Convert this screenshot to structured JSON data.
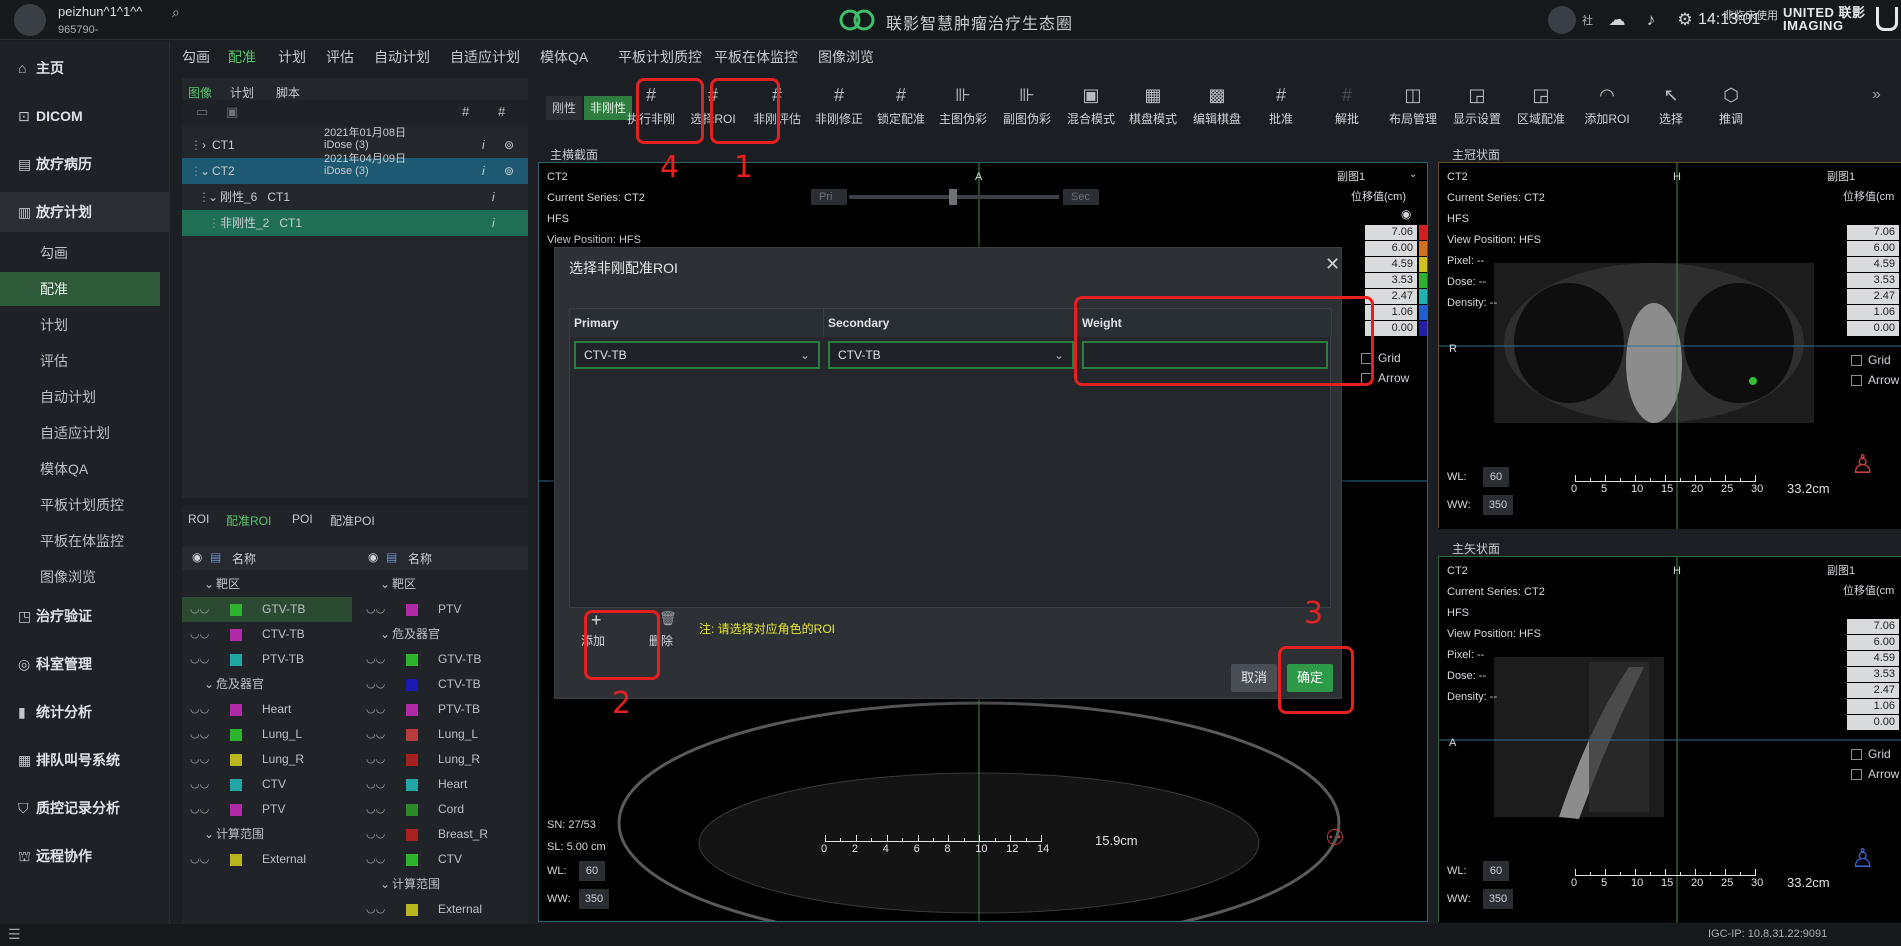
{
  "app": {
    "brand": "联影智慧肿瘤治疗生态圈",
    "clock": "14:13:01",
    "community": "社",
    "nonclinical": "非临床使用",
    "united_imaging": "UNITED 联影 IMAGING"
  },
  "user": {
    "name": "peizhun^1^1^^",
    "id": "965790-"
  },
  "sidebar": {
    "items": [
      {
        "label": "主页",
        "icon": "home-icon",
        "glyph": "⌂"
      },
      {
        "label": "DICOM",
        "icon": "dicom-icon",
        "glyph": "⊡"
      },
      {
        "label": "放疗病历",
        "icon": "record-icon",
        "glyph": "▤"
      },
      {
        "label": "放疗计划",
        "icon": "plan-icon",
        "glyph": "▥"
      },
      {
        "label": "治疗验证",
        "icon": "verify-icon",
        "glyph": "◳"
      },
      {
        "label": "科室管理",
        "icon": "dept-icon",
        "glyph": "◎"
      },
      {
        "label": "统计分析",
        "icon": "stats-icon",
        "glyph": "▮"
      },
      {
        "label": "排队叫号系统",
        "icon": "queue-icon",
        "glyph": "▦"
      },
      {
        "label": "质控记录分析",
        "icon": "shield-icon",
        "glyph": "⛉"
      },
      {
        "label": "远程协作",
        "icon": "remote-icon",
        "glyph": "⛫"
      }
    ],
    "subitems": [
      "勾画",
      "配准",
      "计划",
      "评估",
      "自动计划",
      "自适应计划",
      "模体QA",
      "平板计划质控",
      "平板在体监控",
      "图像浏览"
    ]
  },
  "tabs": [
    "勾画",
    "配准",
    "计划",
    "评估",
    "自动计划",
    "自适应计划",
    "模体QA",
    "平板计划质控",
    "平板在体监控",
    "图像浏览"
  ],
  "leftpanel": {
    "subtabs": [
      "图像",
      "计划",
      "脚本"
    ],
    "tree": [
      {
        "name": "CT1",
        "date": "2021年01月08日",
        "sys": "iDose (3)"
      },
      {
        "name": "CT2",
        "date": "2021年04月09日",
        "sys": "iDose (3)"
      },
      {
        "name": "刚性_6   CT1"
      },
      {
        "name": "非刚性_2   CT1"
      }
    ]
  },
  "roipanel": {
    "tabs": [
      "ROI",
      "配准ROI",
      "POI",
      "配准POI"
    ],
    "col_name": "名称",
    "left": [
      {
        "t": "group",
        "label": "靶区"
      },
      {
        "label": "GTV-TB",
        "color": "#2db52d"
      },
      {
        "label": "CTV-TB",
        "color": "#b02aa8"
      },
      {
        "label": "PTV-TB",
        "color": "#22a7a8"
      },
      {
        "t": "group",
        "label": "危及器官"
      },
      {
        "label": "Heart",
        "color": "#b02aa8"
      },
      {
        "label": "Lung_L",
        "color": "#2db52d"
      },
      {
        "label": "Lung_R",
        "color": "#b8b521"
      },
      {
        "label": "CTV",
        "color": "#22a7a8"
      },
      {
        "label": "PTV",
        "color": "#b02aa8"
      },
      {
        "t": "group",
        "label": "计算范围"
      },
      {
        "label": "External",
        "color": "#b8b521"
      }
    ],
    "right": [
      {
        "t": "group",
        "label": "靶区"
      },
      {
        "label": "PTV",
        "color": "#b02aa8"
      },
      {
        "t": "group",
        "label": "危及器官"
      },
      {
        "label": "GTV-TB",
        "color": "#2db52d"
      },
      {
        "label": "CTV-TB",
        "color": "#1a1ab0"
      },
      {
        "label": "PTV-TB",
        "color": "#b02aa8"
      },
      {
        "label": "Lung_L",
        "color": "#b83a3a"
      },
      {
        "label": "Lung_R",
        "color": "#a82020"
      },
      {
        "label": "Heart",
        "color": "#22a7a8"
      },
      {
        "label": "Cord",
        "color": "#2a8a2a"
      },
      {
        "label": "Breast_R",
        "color": "#a82020"
      },
      {
        "label": "CTV",
        "color": "#2db52d"
      },
      {
        "t": "group",
        "label": "计算范围"
      },
      {
        "label": "External",
        "color": "#b8b521"
      }
    ]
  },
  "toolbar": {
    "toggle_rigid": "刚性",
    "toggle_nonrigid": "非刚性",
    "tools": [
      "执行非刚",
      "选择ROI",
      "非刚评估",
      "非刚修正",
      "锁定配准",
      "主图伪彩",
      "副图伪彩",
      "混合模式",
      "棋盘模式",
      "编辑棋盘",
      "批准",
      "解批",
      "布局管理",
      "显示设置",
      "区域配准",
      "添加ROI",
      "选择",
      "推调"
    ]
  },
  "main_viewer": {
    "section": "主横截面",
    "series": "CT2",
    "current_series": "Current Series: CT2",
    "position": "HFS",
    "view_position": "View Position: HFS",
    "orientation": "A",
    "secondary": "副图1",
    "pri": "Pri",
    "sec": "Sec",
    "unit": "位移值(cm)",
    "legend": [
      "7.06",
      "6.00",
      "4.59",
      "3.53",
      "2.47",
      "1.06",
      "0.00"
    ],
    "legend_colors": [
      "#d02020",
      "#d07020",
      "#d0c020",
      "#30b030",
      "#20b0b0",
      "#2060d0",
      "#2020a0"
    ],
    "grid": "Grid",
    "arrow": "Arrow",
    "sn": "SN: 27/53",
    "sl": "SL: 5.00 cm",
    "wl_label": "WL:",
    "wl": "60",
    "ww_label": "WW:",
    "ww": "350",
    "scale_ticks": [
      "0",
      "2",
      "4",
      "6",
      "8",
      "10",
      "12",
      "14"
    ],
    "scale_len": "15.9cm"
  },
  "coronal": {
    "section": "主冠状面",
    "series": "CT2",
    "current_series": "Current Series: CT2",
    "position": "HFS",
    "view_position": "View Position: HFS",
    "pixel": "Pixel:  --",
    "dose": "Dose:  --",
    "density": "Density:  --",
    "orientation": "H",
    "side": "R",
    "secondary": "副图1",
    "unit": "位移值(cm",
    "legend": [
      "7.06",
      "6.00",
      "4.59",
      "3.53",
      "2.47",
      "1.06",
      "0.00"
    ],
    "wl": "60",
    "ww": "350",
    "scale_ticks": [
      "0",
      "5",
      "10",
      "15",
      "20",
      "25",
      "30"
    ],
    "scale_len": "33.2cm",
    "grid": "Grid",
    "arrow": "Arrow"
  },
  "sagittal": {
    "section": "主矢状面",
    "series": "CT2",
    "current_series": "Current Series: CT2",
    "position": "HFS",
    "view_position": "View Position: HFS",
    "pixel": "Pixel:  --",
    "dose": "Dose:  --",
    "density": "Density:  --",
    "orientation": "H",
    "side": "A",
    "secondary": "副图1",
    "unit": "位移值(cm",
    "legend": [
      "7.06",
      "6.00",
      "4.59",
      "3.53",
      "2.47",
      "1.06",
      "0.00"
    ],
    "wl": "60",
    "ww": "350",
    "scale_ticks": [
      "0",
      "5",
      "10",
      "15",
      "20",
      "25",
      "30"
    ],
    "scale_len": "33.2cm",
    "grid": "Grid",
    "arrow": "Arrow"
  },
  "dialog": {
    "title": "选择非刚配准ROI",
    "col_primary": "Primary",
    "col_secondary": "Secondary",
    "col_weight": "Weight",
    "primary_value": "CTV-TB",
    "secondary_value": "CTV-TB",
    "weight_value": "",
    "add_label": "添加",
    "delete_label": "删除",
    "note": "注: 请选择对应角色的ROI",
    "cancel": "取消",
    "confirm": "确定"
  },
  "annotations": [
    "1",
    "2",
    "3",
    "4"
  ],
  "status": {
    "ip": "IGC-IP: 10.8.31.22:9091"
  }
}
